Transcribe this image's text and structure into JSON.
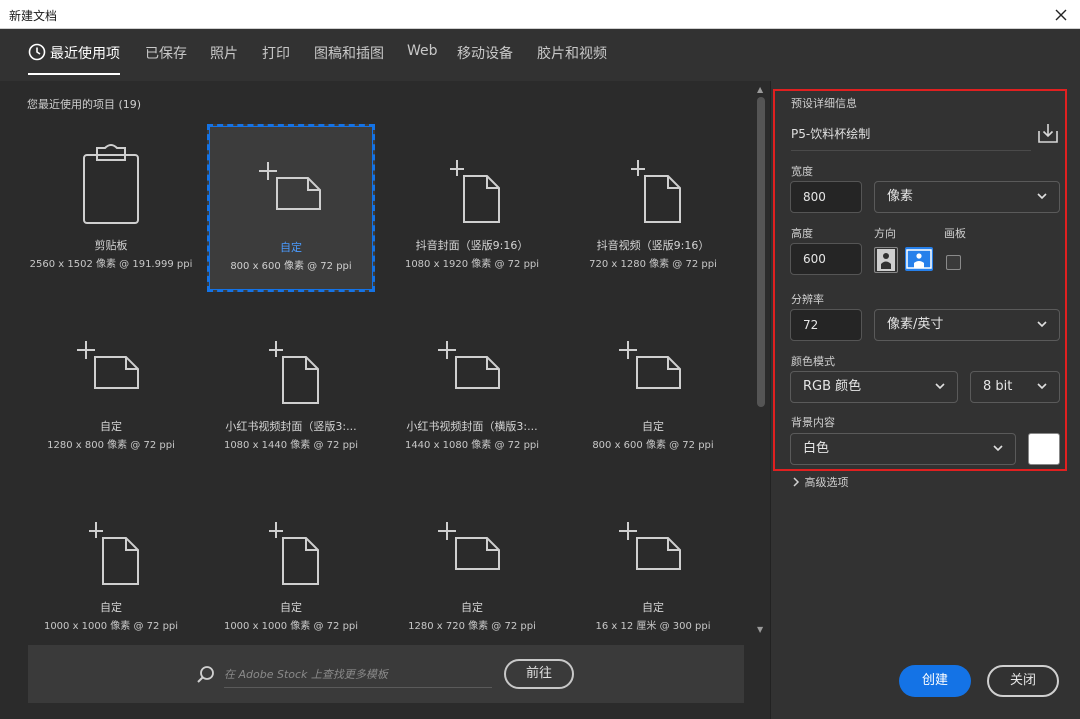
{
  "window": {
    "title": "新建文档"
  },
  "tabs": [
    {
      "label": "最近使用项"
    },
    {
      "label": "已保存"
    },
    {
      "label": "照片"
    },
    {
      "label": "打印"
    },
    {
      "label": "图稿和插图"
    },
    {
      "label": "Web"
    },
    {
      "label": "移动设备"
    },
    {
      "label": "胶片和视频"
    }
  ],
  "recent": {
    "title": "您最近使用的项目 (19)",
    "items": [
      {
        "name": "剪贴板",
        "size": "2560 x 1502 像素 @ 191.999 ppi",
        "icon": "clipboard-icon"
      },
      {
        "name": "自定",
        "size": "800 x 600 像素 @ 72 ppi",
        "icon": "landscape-doc-icon",
        "selected": true
      },
      {
        "name": "抖音封面（竖版9:16）",
        "size": "1080 x 1920 像素 @ 72 ppi",
        "icon": "portrait-doc-icon"
      },
      {
        "name": "抖音视频（竖版9:16）",
        "size": "720 x 1280 像素 @ 72 ppi",
        "icon": "portrait-doc-icon"
      },
      {
        "name": "自定",
        "size": "1280 x 800 像素 @ 72 ppi",
        "icon": "landscape-doc-icon"
      },
      {
        "name": "小红书视频封面（竖版3:...",
        "size": "1080 x 1440 像素 @ 72 ppi",
        "icon": "portrait-doc-icon"
      },
      {
        "name": "小红书视频封面（横版3:...",
        "size": "1440 x 1080 像素 @ 72 ppi",
        "icon": "landscape-doc-icon"
      },
      {
        "name": "自定",
        "size": "800 x 600 像素 @ 72 ppi",
        "icon": "landscape-doc-icon"
      },
      {
        "name": "自定",
        "size": "1000 x 1000 像素 @ 72 ppi",
        "icon": "portrait-doc-icon"
      },
      {
        "name": "自定",
        "size": "1000 x 1000 像素 @ 72 ppi",
        "icon": "portrait-doc-icon"
      },
      {
        "name": "自定",
        "size": "1280 x 720 像素 @ 72 ppi",
        "icon": "landscape-doc-icon"
      },
      {
        "name": "自定",
        "size": "16 x 12 厘米 @ 300 ppi",
        "icon": "landscape-doc-icon"
      }
    ]
  },
  "stock": {
    "placeholder": "在 Adobe Stock 上查找更多模板",
    "go_label": "前往"
  },
  "preset": {
    "section_label": "预设详细信息",
    "name": "P5-饮料杯绘制",
    "width_label": "宽度",
    "width_value": "800",
    "width_unit": "像素",
    "height_label": "高度",
    "height_value": "600",
    "orientation_label": "方向",
    "artboard_label": "画板",
    "resolution_label": "分辨率",
    "resolution_value": "72",
    "resolution_unit": "像素/英寸",
    "color_mode_label": "颜色模式",
    "color_mode": "RGB 颜色",
    "bit_depth": "8 bit",
    "background_label": "背景内容",
    "background": "白色",
    "background_color": "#ffffff",
    "advanced_label": "高级选项"
  },
  "buttons": {
    "create": "创建",
    "close": "关闭"
  },
  "colors": {
    "accent": "#1473e6",
    "highlight_border": "#e02020"
  }
}
